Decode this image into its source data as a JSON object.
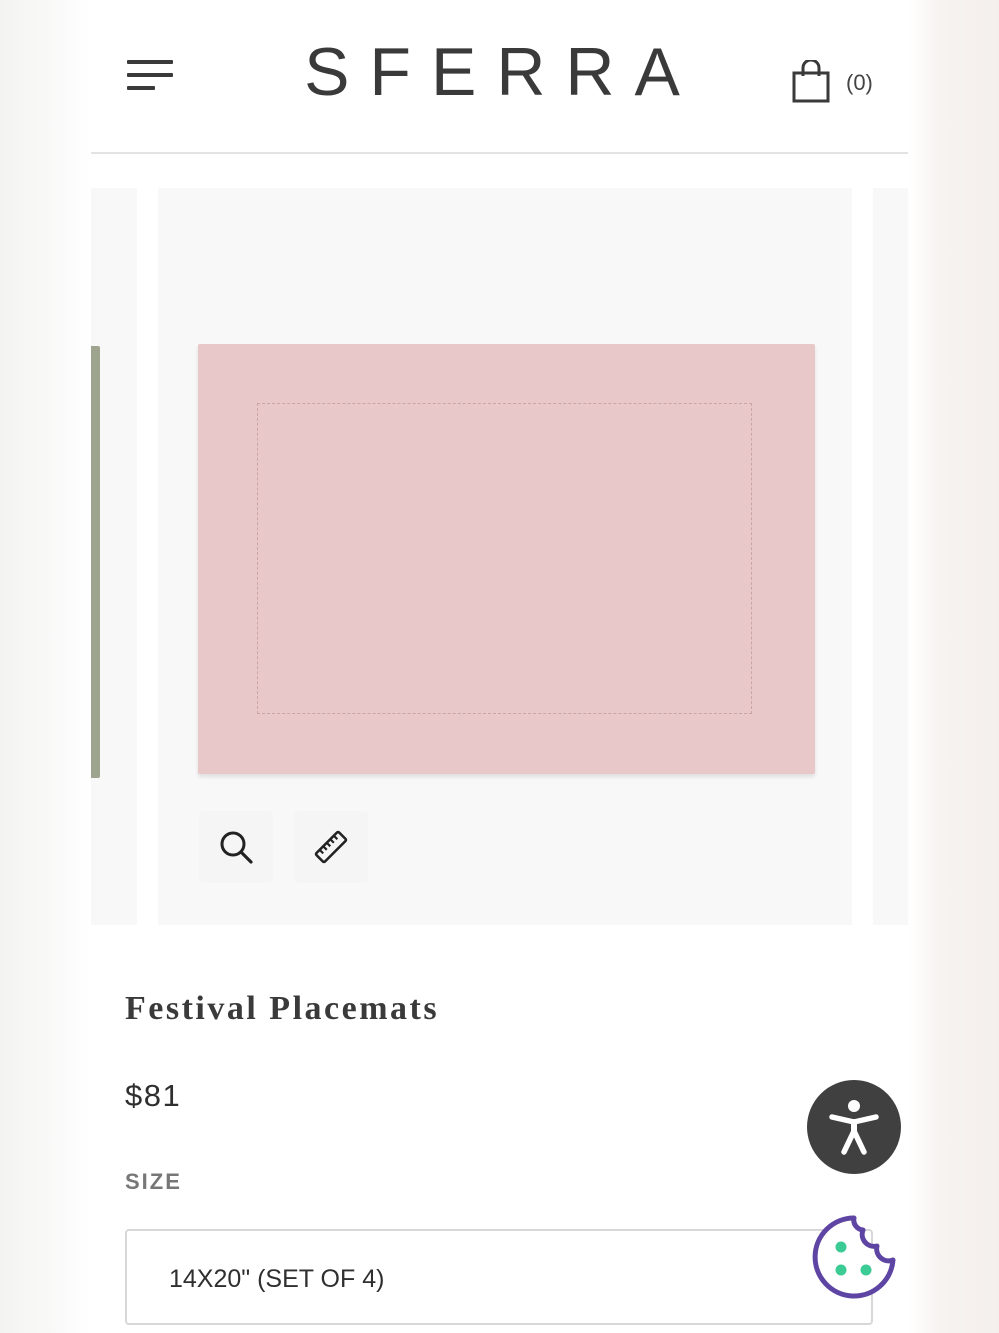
{
  "header": {
    "logo": "SFERRA",
    "cart_count": "(0)"
  },
  "gallery": {
    "main_image": "rose-placemat",
    "prev_image_color": "#9fa48e",
    "main_image_color": "#e8c8c9",
    "tools": [
      "magnifier-icon",
      "ruler-icon"
    ]
  },
  "product": {
    "title": "Festival Placemats",
    "price": "$81",
    "size_label": "SIZE",
    "size_selected": "14X20\" (SET OF 4)"
  },
  "widgets": {
    "accessibility_icon": "accessibility-person-icon",
    "cookie_icon": "cookie-icon",
    "accessibility_color": "#404040",
    "cookie_color": "#5f45a3",
    "cookie_dot_color": "#3ccb94"
  }
}
